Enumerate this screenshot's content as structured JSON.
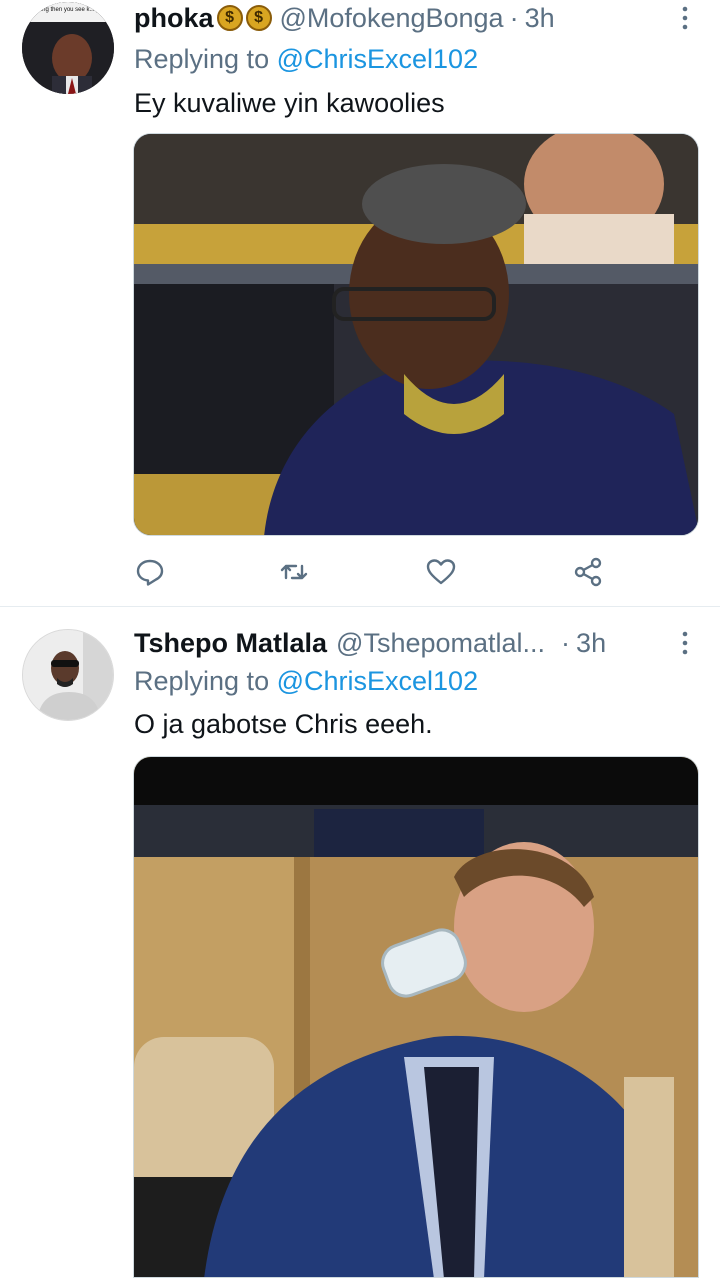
{
  "tweets": [
    {
      "name": "phoka",
      "emoji": [
        "$",
        "$"
      ],
      "handle": "@MofokengBonga",
      "separator": "·",
      "time": "3h",
      "replying_prefix": "Replying to ",
      "replying_to": "@ChrisExcel102",
      "text": "Ey kuvaliwe yin kawoolies",
      "avatar_caption": "sleeping then you see k... party"
    },
    {
      "name": "Tshepo Matlala",
      "handle": "@Tshepomatlal...",
      "separator": "·",
      "time": "3h",
      "replying_prefix": "Replying to ",
      "replying_to": "@ChrisExcel102",
      "text": "O ja gabotse Chris eeeh."
    }
  ],
  "icons": {
    "reply": "speech-bubble-icon",
    "retweet": "retweet-arrows-icon",
    "like": "heart-icon",
    "share": "share-nodes-icon",
    "more": "vertical-dots-icon"
  },
  "colors": {
    "link": "#1b95e0",
    "secondary": "#5b7083",
    "primary_text": "#0f1419",
    "divider": "#e6ecf0"
  }
}
